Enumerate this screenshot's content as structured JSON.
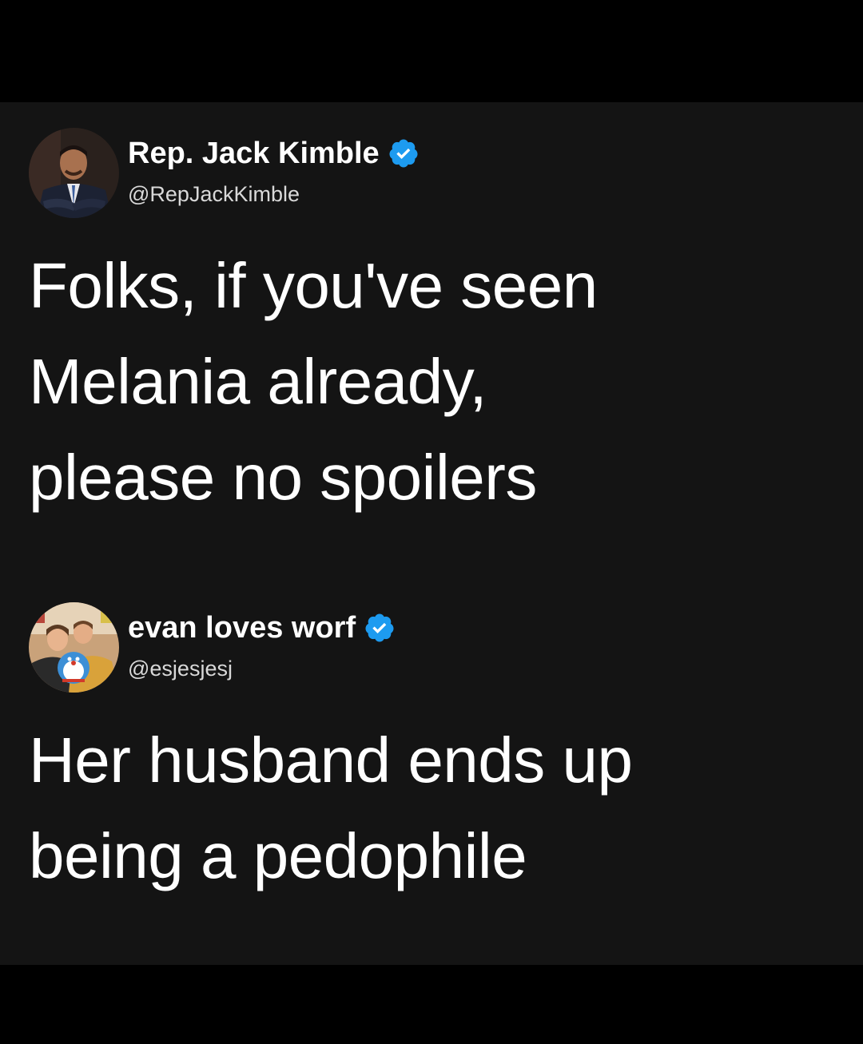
{
  "tweets": [
    {
      "display_name": "Rep. Jack Kimble",
      "handle": "@RepJackKimble",
      "verified": true,
      "avatar_icon": "man-in-suit-avatar",
      "text_lines": [
        "Folks, if you've seen",
        "Melania already,",
        "please no spoilers"
      ]
    },
    {
      "display_name": "evan loves worf",
      "handle": "@esjesjesj",
      "verified": true,
      "avatar_icon": "two-people-with-plush-avatar",
      "text_lines": [
        "Her husband ends up",
        "being a pedophile"
      ]
    }
  ],
  "colors": {
    "background": "#000000",
    "card": "#141414",
    "text": "#ffffff",
    "handle": "#d9d9d9",
    "verified_badge": "#1d9bf0"
  }
}
